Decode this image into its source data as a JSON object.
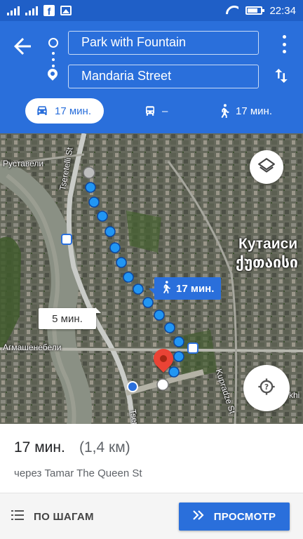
{
  "status_bar": {
    "time": "22:34",
    "icons": [
      "signal-icon",
      "signal-icon",
      "facebook-icon",
      "image-icon",
      "wifi-icon",
      "battery-icon"
    ]
  },
  "header": {
    "origin": "Park with Fountain",
    "destination": "Mandaria Street",
    "modes": [
      {
        "name": "car",
        "label": "17 мин.",
        "selected": true
      },
      {
        "name": "transit",
        "label": "–",
        "selected": false
      },
      {
        "name": "walk",
        "label": "17 мин.",
        "selected": false
      }
    ]
  },
  "map": {
    "labels": {
      "rustaveli": "Руставели",
      "tseretelli": "Tseretelli St",
      "kutaisi_ru": "Кутаиси",
      "kutaisi_ka": "ქუთაისი",
      "agmashenebeli": "Агмашенебели",
      "kupradze": "Kupradze St",
      "tsere_bottom": "Tsere",
      "khi": "khi"
    },
    "walk_callout": "17 мин.",
    "car_callout": "5 мин."
  },
  "summary": {
    "duration": "17 мин.",
    "distance": "(1,4 км)",
    "via": "через Tamar The Queen St"
  },
  "footer": {
    "steps_label": "ПО ШАГАМ",
    "preview_label": "ПРОСМОТР"
  },
  "colors": {
    "accent": "#2a6fdb",
    "status_bar": "#1f5fc7",
    "route_dots": "#2196f3",
    "pin": "#ea4335"
  }
}
